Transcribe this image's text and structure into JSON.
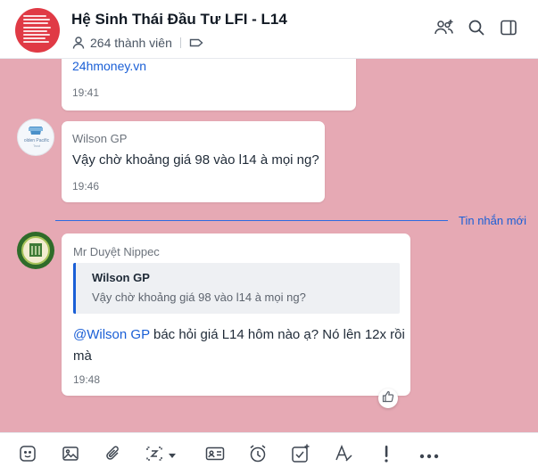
{
  "header": {
    "title": "Hệ Sinh Thái Đầu Tư LFI - L14",
    "members": "264 thành viên",
    "icons": [
      "user-plus-icon",
      "search-icon",
      "sidebar-toggle-icon"
    ]
  },
  "messages": [
    {
      "link": "24hmoney.vn",
      "time": "19:41"
    },
    {
      "sender": "Wilson GP",
      "text": "Vậy chờ khoảng giá 98 vào l14 à mọi ng?",
      "time": "19:46"
    },
    {
      "sender": "Mr Duyệt Nippec",
      "quote": {
        "name": "Wilson GP",
        "text": "Vậy chờ khoảng giá 98 vào l14 à mọi ng?"
      },
      "mention": "@Wilson GP",
      "text_line1": " bác hỏi giá L14 hôm nào ạ? Nó lên 12x rồi",
      "text_line2": "mà",
      "time": "19:48"
    }
  ],
  "divider_label": "Tin nhắn mới",
  "toolbar": [
    "sticker-icon",
    "image-icon",
    "attachment-icon",
    "screenshot-icon",
    "business-card-icon",
    "reminder-clock-icon",
    "task-check-icon",
    "text-format-icon",
    "urgent-icon",
    "more-icon"
  ],
  "colors": {
    "chat_bg": "#e6a9b4",
    "accent": "#1a5fd6",
    "group_avatar": "#e03a45"
  }
}
